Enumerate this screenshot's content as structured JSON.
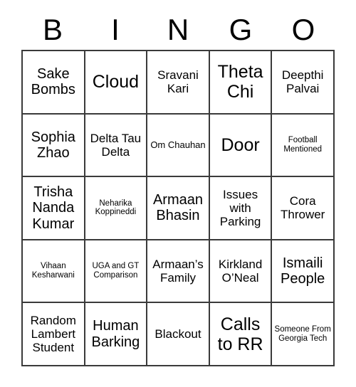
{
  "card": {
    "title": "BINGO",
    "header_letters": [
      "B",
      "I",
      "N",
      "G",
      "O"
    ],
    "colors": {
      "background": "#ffffff",
      "text": "#000000",
      "grid_line": "#3a3a3a"
    },
    "grid": {
      "columns": 5,
      "rows": 5,
      "cells": [
        [
          {
            "text": "Sake Bombs",
            "size": "lg"
          },
          {
            "text": "Cloud",
            "size": "xl"
          },
          {
            "text": "Sravani Kari",
            "size": "md"
          },
          {
            "text": "Theta Chi",
            "size": "xl"
          },
          {
            "text": "Deepthi Palvai",
            "size": "md"
          }
        ],
        [
          {
            "text": "Sophia Zhao",
            "size": "lg"
          },
          {
            "text": "Delta Tau Delta",
            "size": "md"
          },
          {
            "text": "Om Chauhan",
            "size": "sm"
          },
          {
            "text": "Door",
            "size": "xl"
          },
          {
            "text": "Football Mentioned",
            "size": "xs"
          }
        ],
        [
          {
            "text": "Trisha Nanda Kumar",
            "size": "lg"
          },
          {
            "text": "Neharika Koppineddi",
            "size": "xs"
          },
          {
            "text": "Armaan Bhasin",
            "size": "lg"
          },
          {
            "text": "Issues with Parking",
            "size": "md"
          },
          {
            "text": "Cora Thrower",
            "size": "md"
          }
        ],
        [
          {
            "text": "Vihaan Kesharwani",
            "size": "xs"
          },
          {
            "text": "UGA and GT Comparison",
            "size": "xs"
          },
          {
            "text": "Armaan’s Family",
            "size": "md"
          },
          {
            "text": "Kirkland O’Neal",
            "size": "md"
          },
          {
            "text": "Ismaili People",
            "size": "lg"
          }
        ],
        [
          {
            "text": "Random Lambert Student",
            "size": "md"
          },
          {
            "text": "Human Barking",
            "size": "lg"
          },
          {
            "text": "Blackout",
            "size": "md"
          },
          {
            "text": "Calls to RR",
            "size": "xl"
          },
          {
            "text": "Someone From Georgia Tech",
            "size": "xs"
          }
        ]
      ]
    }
  }
}
